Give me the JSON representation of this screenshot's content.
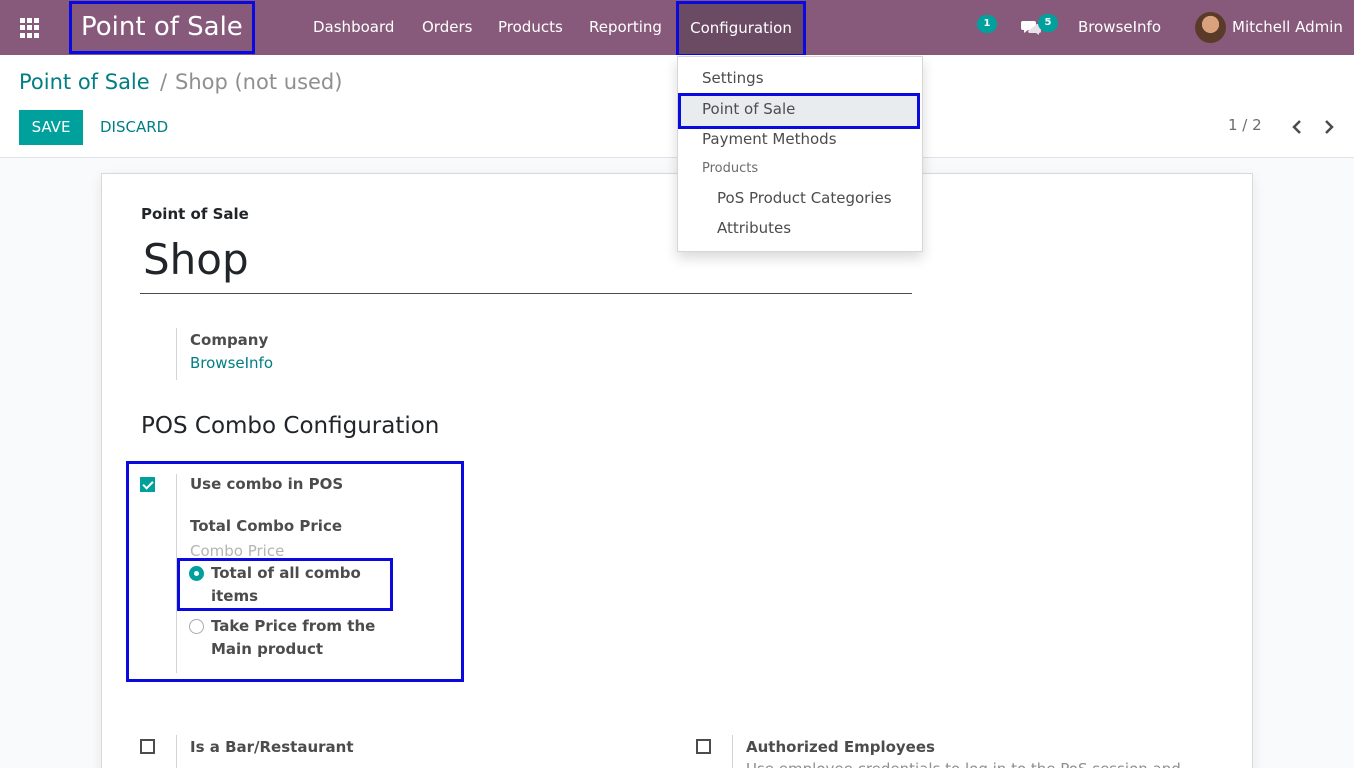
{
  "navbar": {
    "app_title": "Point of Sale",
    "menu": [
      "Dashboard",
      "Orders",
      "Products",
      "Reporting",
      "Configuration"
    ],
    "activity_count": "1",
    "message_count": "5",
    "company": "BrowseInfo",
    "user": "Mitchell Admin"
  },
  "control": {
    "breadcrumb_parent": "Point of Sale",
    "breadcrumb_sep": "/",
    "breadcrumb_current": "Shop (not used)",
    "save_label": "SAVE",
    "discard_label": "DISCARD",
    "pager": "1 / 2"
  },
  "dropdown": {
    "items": [
      "Settings",
      "Point of Sale",
      "Payment Methods"
    ],
    "products_header": "Products",
    "product_items": [
      "PoS Product Categories",
      "Attributes"
    ]
  },
  "form": {
    "record_label": "Point of Sale",
    "name": "Shop",
    "company_label": "Company",
    "company_value": "BrowseInfo",
    "section_title": "POS Combo Configuration",
    "use_combo_label": "Use combo in POS",
    "use_combo_checked": true,
    "total_combo_price_label": "Total Combo Price",
    "combo_price_placeholder": "Combo Price",
    "option_total_line1": "Total of all combo",
    "option_total_line2": "items",
    "option_main_line1": "Take Price from the",
    "option_main_line2": "Main product",
    "bar_restaurant_label": "Is a Bar/Restaurant",
    "authorized_label": "Authorized Employees",
    "authorized_desc": "Use employee credentials to log in to the PoS session and"
  },
  "colors": {
    "navbar": "#875a7b",
    "accent": "#00a09d",
    "link": "#017e84",
    "highlight_border": "#0a0ae0"
  }
}
